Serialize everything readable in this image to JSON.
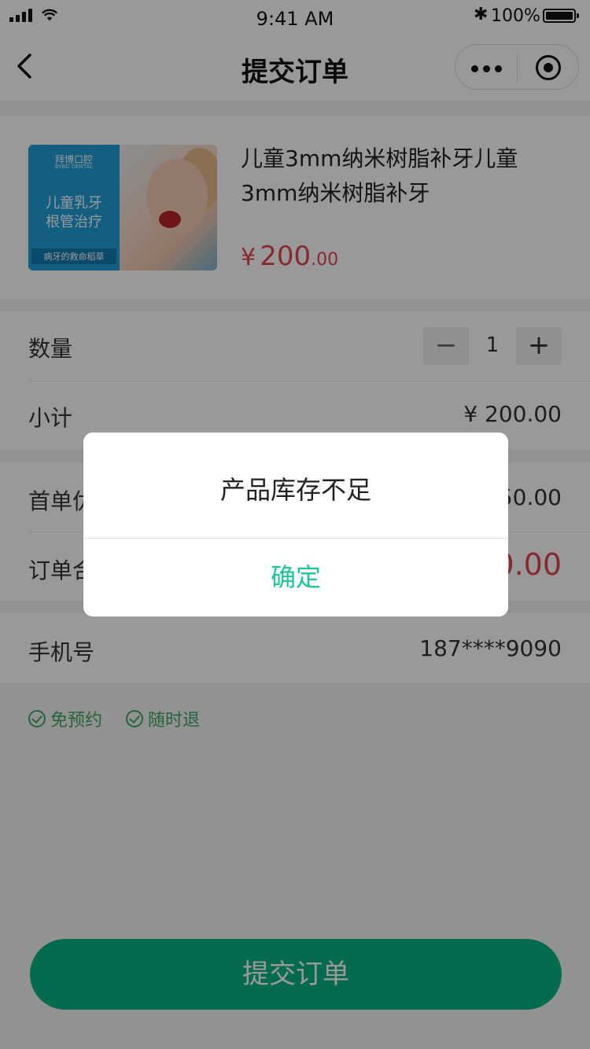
{
  "status_bar": {
    "time": "9:41 AM",
    "battery": "100%"
  },
  "nav": {
    "title": "提交订单"
  },
  "product": {
    "title": "儿童3mm纳米树脂补牙儿童3mm纳米树脂补牙",
    "price_currency": "¥",
    "price_integer": "200",
    "price_decimal": ".00",
    "image": {
      "brand": "拜博口腔",
      "brand_en": "BYBO DENTAL",
      "line1": "儿童乳牙",
      "line2": "根管治疗",
      "tag": "病牙的救命稻草"
    }
  },
  "quantity": {
    "label": "数量",
    "value": "1",
    "minus": "−",
    "plus": "+"
  },
  "subtotal": {
    "label": "小计",
    "value": "¥ 200.00"
  },
  "first_order": {
    "label": "首单优惠",
    "value": "- ¥ 50.00"
  },
  "order_total": {
    "label": "订单合计",
    "value": "¥ 150.00"
  },
  "phone": {
    "label": "手机号",
    "value": "187****9090"
  },
  "badges": [
    "免预约",
    "随时退"
  ],
  "submit_button": "提交订单",
  "dialog": {
    "message": "产品库存不足",
    "confirm": "确定"
  },
  "colors": {
    "accent": "#09b285",
    "price": "#e2474f",
    "badge": "#3ba75f",
    "confirm": "#1bc79a"
  }
}
